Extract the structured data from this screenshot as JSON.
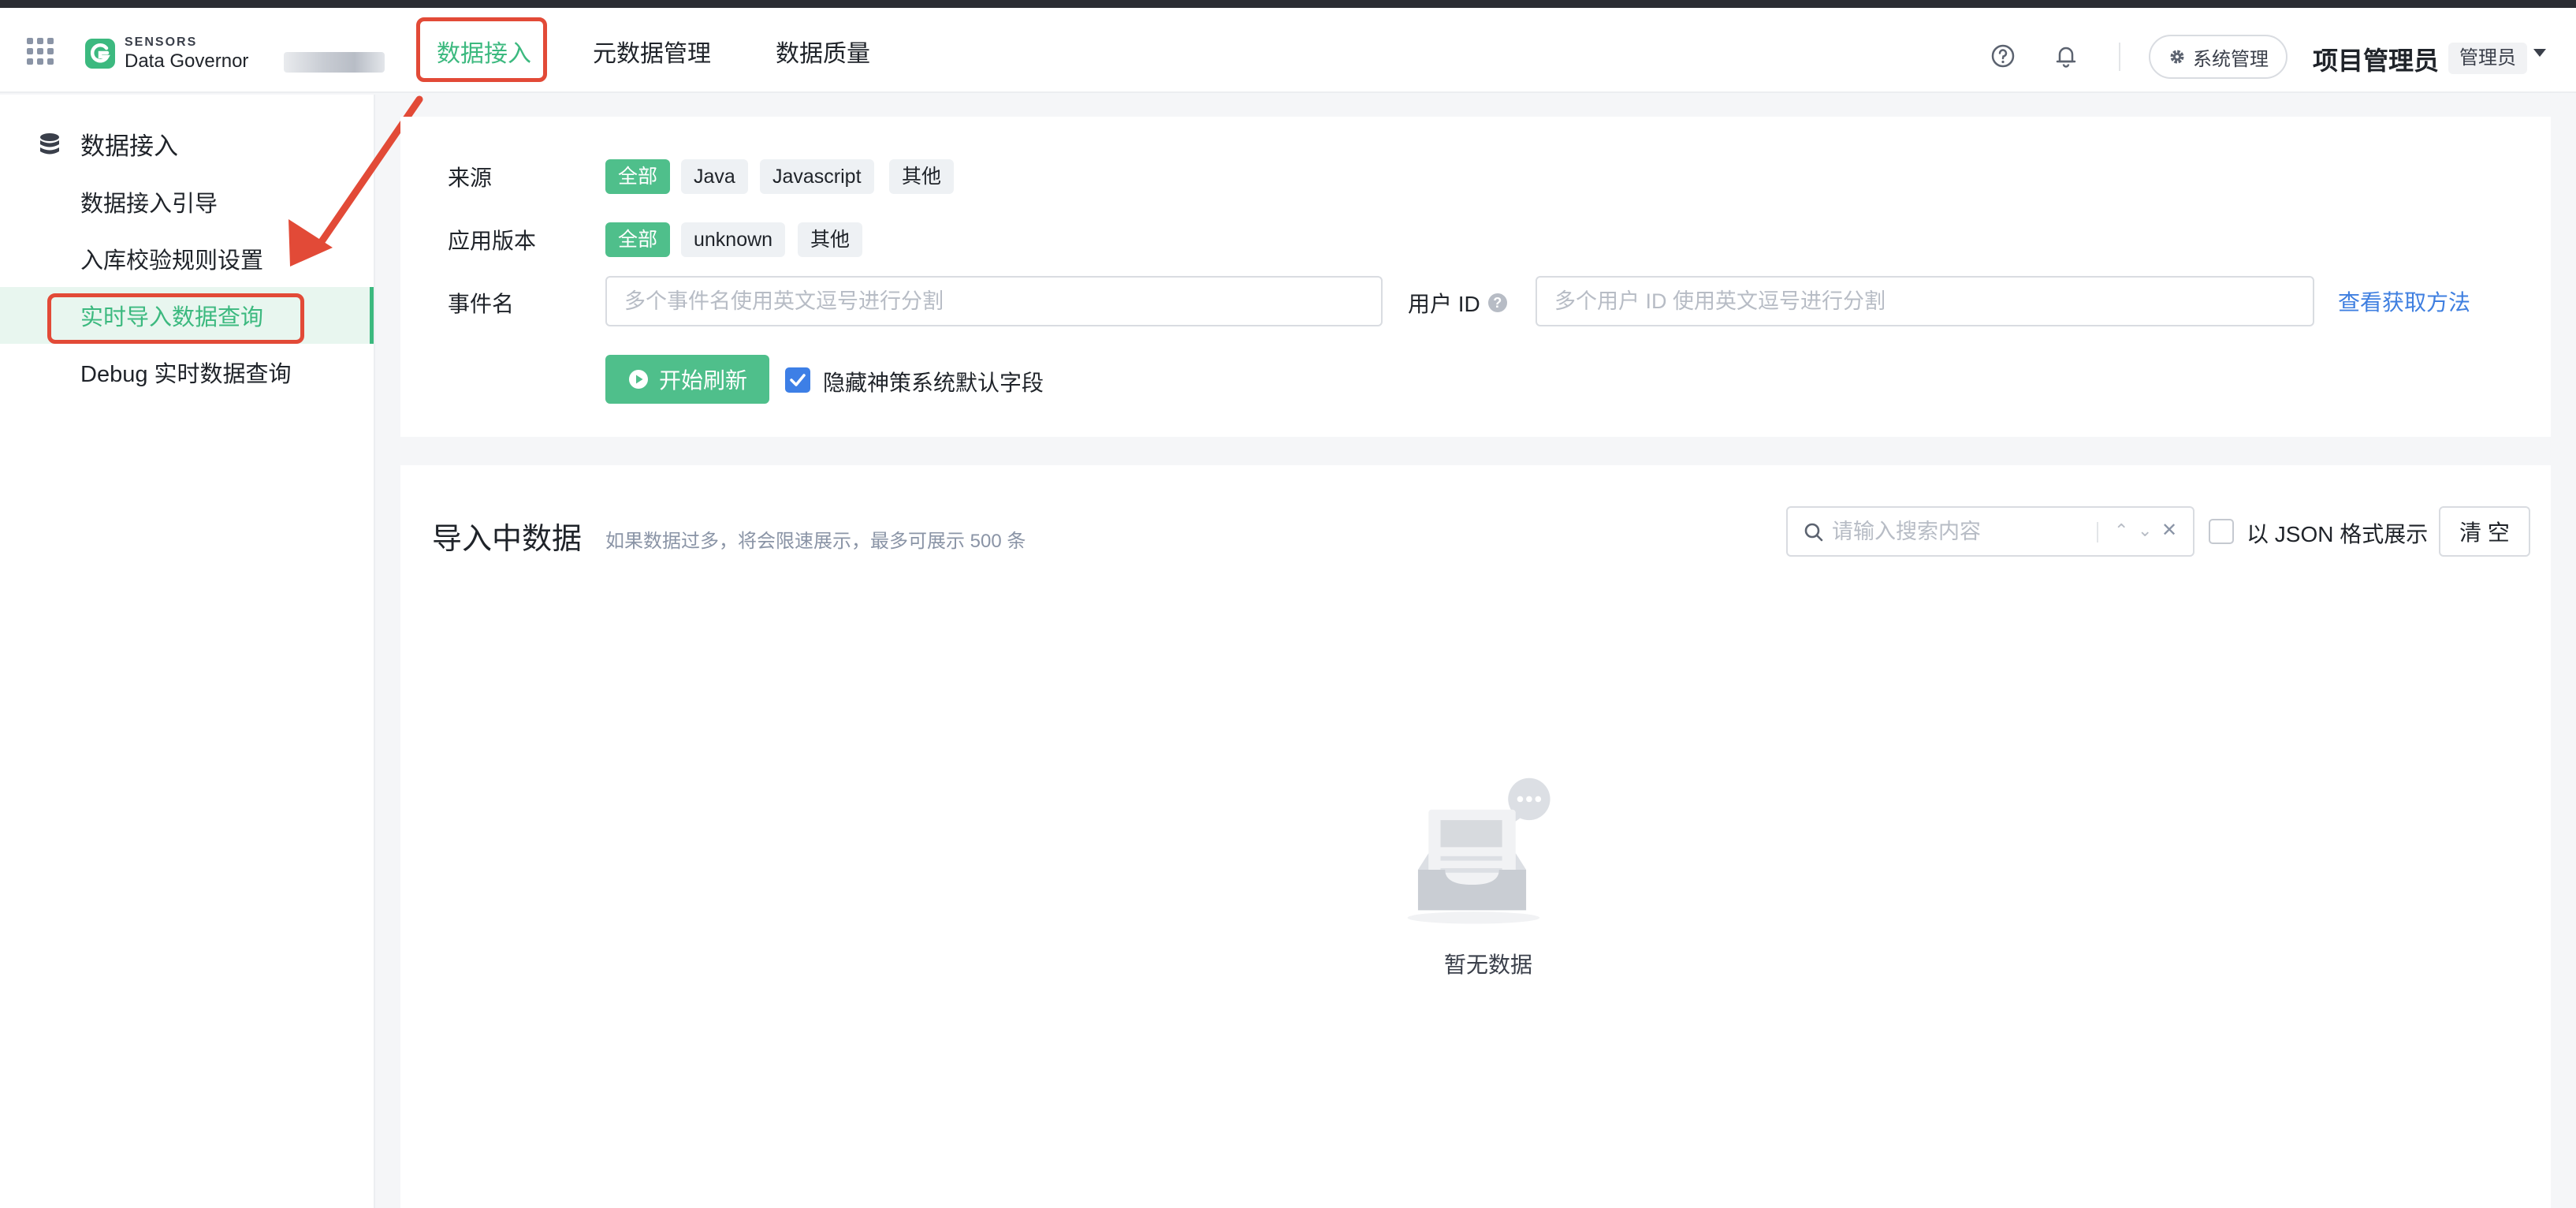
{
  "header": {
    "brand": "SENSORS",
    "product": "Data Governor",
    "nav": [
      "数据接入",
      "元数据管理",
      "数据质量"
    ],
    "active_nav": "数据接入",
    "system_button": "系统管理",
    "user_name": "项目管理员",
    "user_role": "管理员"
  },
  "sidebar": {
    "section_title": "数据接入",
    "items": [
      "数据接入引导",
      "入库校验规则设置",
      "实时导入数据查询",
      "Debug 实时数据查询"
    ],
    "active_item": "实时导入数据查询"
  },
  "filters": {
    "source_label": "来源",
    "source_tags": [
      "全部",
      "Java",
      "Javascript",
      "其他"
    ],
    "version_label": "应用版本",
    "version_tags": [
      "全部",
      "unknown",
      "其他"
    ],
    "event_label": "事件名",
    "event_placeholder": "多个事件名使用英文逗号进行分割",
    "user_id_label": "用户 ID",
    "user_id_placeholder": "多个用户 ID 使用英文逗号进行分割",
    "help_link": "查看获取方法",
    "start_button": "开始刷新",
    "hide_fields_label": "隐藏神策系统默认字段",
    "hide_fields_checked": true
  },
  "data_panel": {
    "title": "导入中数据",
    "subtitle": "如果数据过多，将会限速展示，最多可展示 500 条",
    "search_placeholder": "请输入搜索内容",
    "json_label": "以 JSON 格式展示",
    "json_checked": false,
    "clear_button": "清 空",
    "empty_text": "暂无数据"
  },
  "colors": {
    "accent": "#3cb97f",
    "highlight": "#e24a37",
    "link": "#3f7fe0"
  }
}
